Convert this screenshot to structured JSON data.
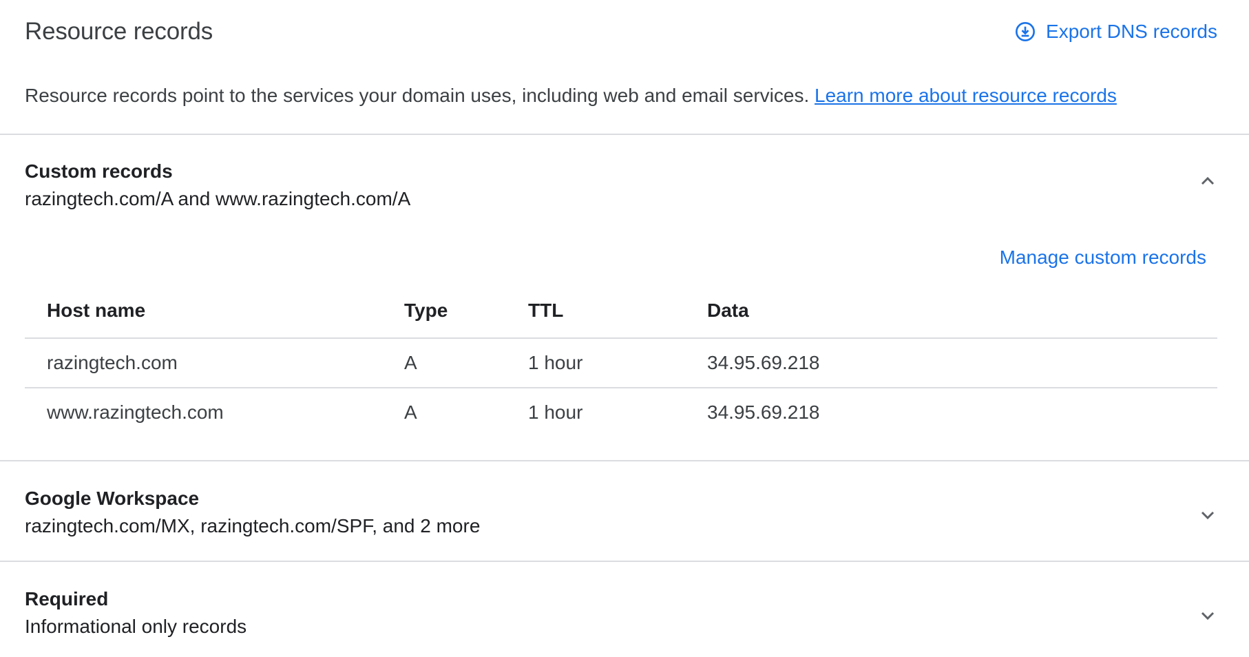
{
  "header": {
    "title": "Resource records",
    "export_label": "Export DNS records"
  },
  "description": {
    "text": "Resource records point to the services your domain uses, including web and email services. ",
    "link_label": "Learn more about resource records"
  },
  "sections": {
    "custom": {
      "title": "Custom records",
      "summary": "razingtech.com/A and www.razingtech.com/A",
      "expanded": true,
      "manage_label": "Manage custom records",
      "columns": [
        "Host name",
        "Type",
        "TTL",
        "Data"
      ],
      "rows": [
        [
          "razingtech.com",
          "A",
          "1 hour",
          "34.95.69.218"
        ],
        [
          "www.razingtech.com",
          "A",
          "1 hour",
          "34.95.69.218"
        ]
      ]
    },
    "workspace": {
      "title": "Google Workspace",
      "summary": "razingtech.com/MX, razingtech.com/SPF, and 2 more",
      "expanded": false
    },
    "required": {
      "title": "Required",
      "summary": "Informational only records",
      "expanded": false
    }
  },
  "colors": {
    "accent": "#1a73e8",
    "divider": "#dadce0",
    "text": "#202124",
    "secondary_text": "#3c4043",
    "icon": "#5f6368"
  }
}
